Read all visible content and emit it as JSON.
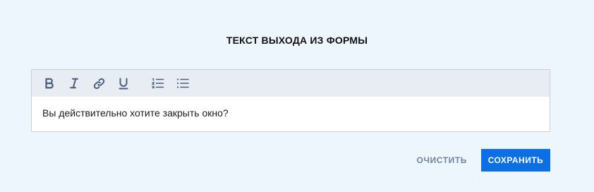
{
  "form": {
    "title": "ТЕКСТ ВЫХОДА ИЗ ФОРМЫ"
  },
  "editor": {
    "toolbar": [
      {
        "name": "bold-icon",
        "label": "B"
      },
      {
        "name": "italic-icon",
        "label": "I"
      },
      {
        "name": "link-icon",
        "label": ""
      },
      {
        "name": "underline-icon",
        "label": "U"
      },
      {
        "name": "ordered-list-icon",
        "label": ""
      },
      {
        "name": "bulleted-list-icon",
        "label": ""
      }
    ],
    "content": "Вы действительно хотите закрыть окно?"
  },
  "actions": {
    "clear_label": "ОЧИСТИТЬ",
    "save_label": "СОХРАНИТЬ"
  },
  "colors": {
    "background": "#eef6fd",
    "toolbar": "#e8edf4",
    "icon": "#4b5e7d",
    "primary": "#0c6fe6",
    "secondary_text": "#6f829f"
  }
}
